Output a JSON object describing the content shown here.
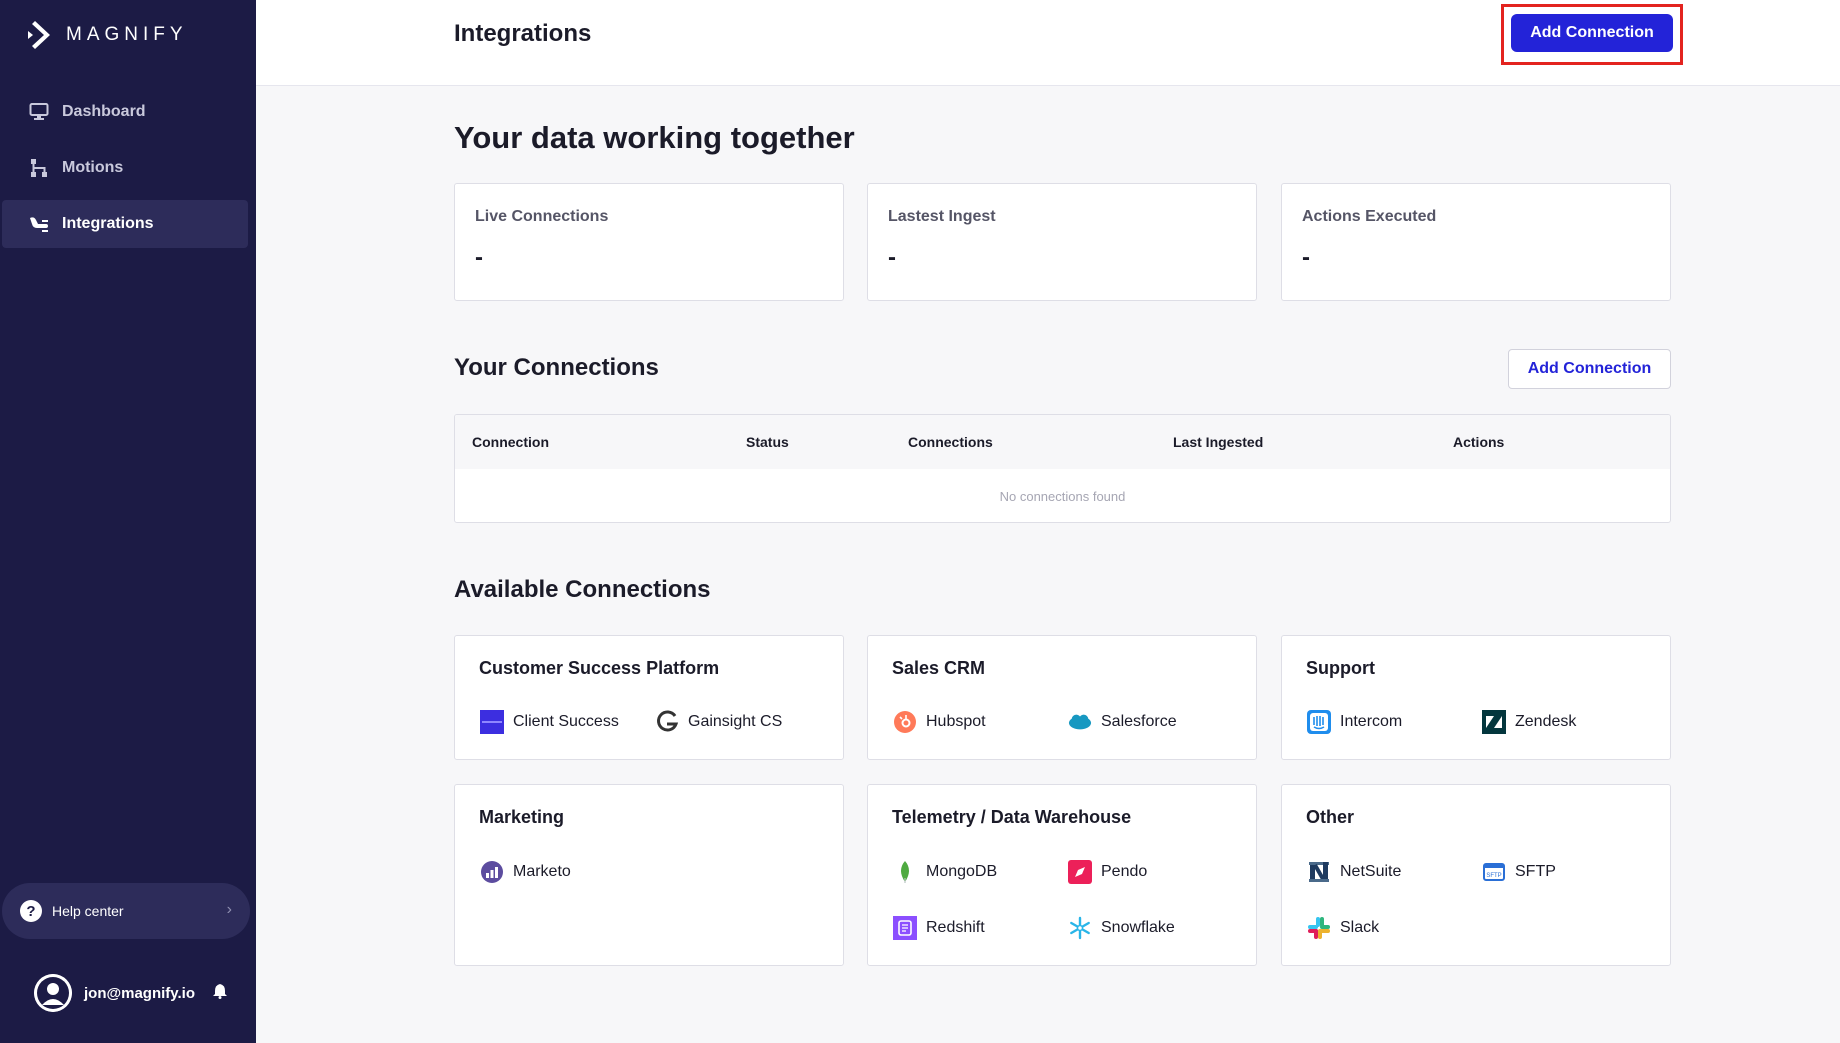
{
  "brand": {
    "name": "MAGNIFY",
    "logo_icon": "magnify-logo-icon"
  },
  "sidebar": {
    "items": [
      {
        "label": "Dashboard",
        "icon": "monitor-icon",
        "active": false
      },
      {
        "label": "Motions",
        "icon": "motions-icon",
        "active": false
      },
      {
        "label": "Integrations",
        "icon": "integrations-icon",
        "active": true
      }
    ],
    "help_label": "Help center",
    "user_email": "jon@magnify.io"
  },
  "header": {
    "title": "Integrations",
    "add_label": "Add Connection"
  },
  "hero": {
    "title": "Your data working together"
  },
  "stats": [
    {
      "label": "Live Connections",
      "value": "-"
    },
    {
      "label": "Lastest Ingest",
      "value": "-"
    },
    {
      "label": "Actions Executed",
      "value": "-"
    }
  ],
  "connections": {
    "title": "Your Connections",
    "add_label": "Add Connection",
    "columns": [
      "Connection",
      "Status",
      "Connections",
      "Last Ingested",
      "Actions"
    ],
    "empty_text": "No connections found"
  },
  "available": {
    "title": "Available Connections",
    "categories": [
      {
        "title": "Customer Success Platform",
        "items": [
          {
            "label": "Client Success",
            "icon": "clientsuccess-icon"
          },
          {
            "label": "Gainsight CS",
            "icon": "gainsight-icon"
          }
        ]
      },
      {
        "title": "Sales CRM",
        "items": [
          {
            "label": "Hubspot",
            "icon": "hubspot-icon"
          },
          {
            "label": "Salesforce",
            "icon": "salesforce-icon"
          }
        ]
      },
      {
        "title": "Support",
        "items": [
          {
            "label": "Intercom",
            "icon": "intercom-icon"
          },
          {
            "label": "Zendesk",
            "icon": "zendesk-icon"
          }
        ]
      },
      {
        "title": "Marketing",
        "items": [
          {
            "label": "Marketo",
            "icon": "marketo-icon"
          }
        ]
      },
      {
        "title": "Telemetry / Data Warehouse",
        "items": [
          {
            "label": "MongoDB",
            "icon": "mongodb-icon"
          },
          {
            "label": "Pendo",
            "icon": "pendo-icon"
          },
          {
            "label": "Redshift",
            "icon": "redshift-icon"
          },
          {
            "label": "Snowflake",
            "icon": "snowflake-icon"
          }
        ]
      },
      {
        "title": "Other",
        "items": [
          {
            "label": "NetSuite",
            "icon": "netsuite-icon"
          },
          {
            "label": "SFTP",
            "icon": "sftp-icon"
          },
          {
            "label": "Slack",
            "icon": "slack-icon"
          }
        ]
      }
    ]
  },
  "colors": {
    "sidebar_bg": "#1c1b45",
    "accent": "#2323d8",
    "highlight": "#e3231f"
  }
}
